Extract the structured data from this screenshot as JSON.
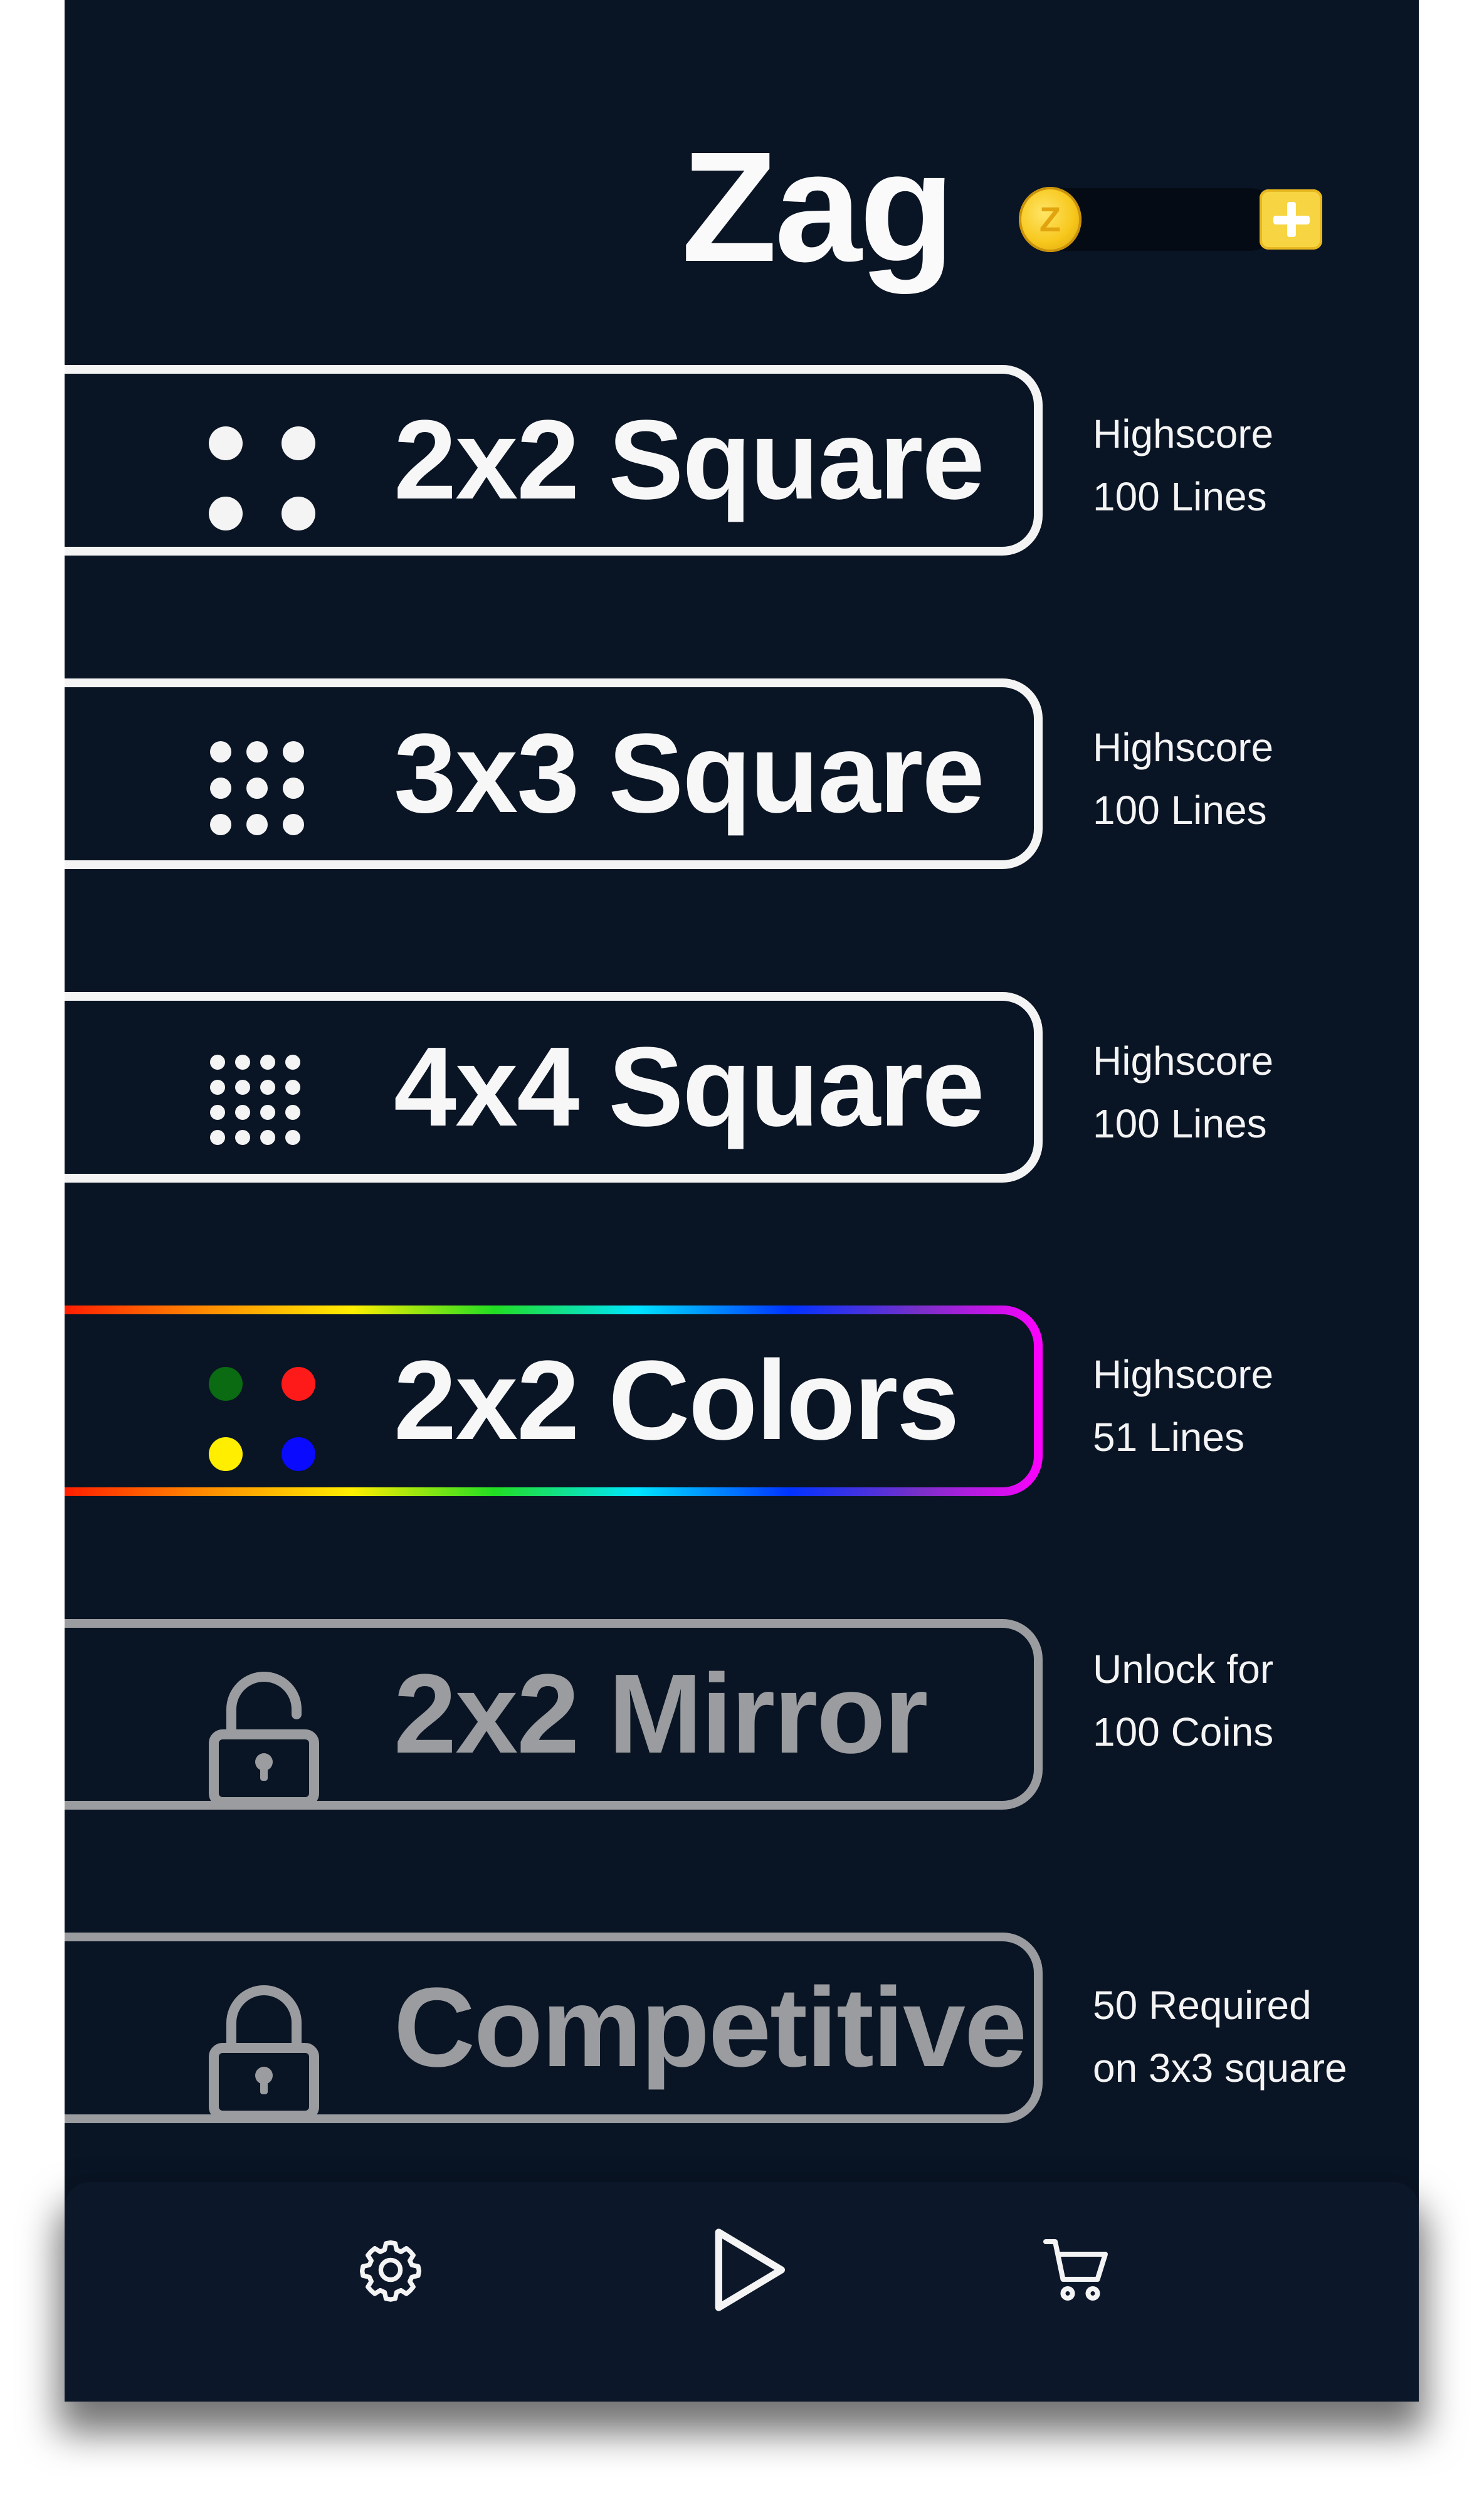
{
  "app": {
    "title": "Zag"
  },
  "wallet": {
    "coin_symbol": "Z",
    "coin_count": ""
  },
  "modes": [
    {
      "label": "2x2 Square",
      "status_line1": "Highscore",
      "status_line2": "100 Lines",
      "icon": "dots-2x2-icon"
    },
    {
      "label": "3x3 Square",
      "status_line1": "Highscore",
      "status_line2": "100 Lines",
      "icon": "dots-3x3-icon"
    },
    {
      "label": "4x4 Square",
      "status_line1": "Highscore",
      "status_line2": "100 Lines",
      "icon": "dots-4x4-icon"
    },
    {
      "label": "2x2 Colors",
      "status_line1": "Highscore",
      "status_line2": "51 Lines",
      "icon": "colored-dots-icon",
      "dot_colors": [
        "#0a6b12",
        "#ff1a1a",
        "#ffee00",
        "#0a0aff"
      ]
    },
    {
      "label": "2x2 Mirror",
      "status_line1": "Unlock for",
      "status_line2": "100 Coins",
      "icon": "unlocked-padlock-icon",
      "locked": true
    },
    {
      "label": "Competitive",
      "status_line1": "50 Required",
      "status_line2": "on 3x3 square",
      "icon": "padlock-icon",
      "locked": true
    }
  ],
  "bottom_nav": [
    {
      "name": "settings",
      "icon": "gear-icon"
    },
    {
      "name": "play",
      "icon": "play-icon"
    },
    {
      "name": "shop",
      "icon": "cart-icon"
    }
  ],
  "colors": {
    "background": "#091424",
    "button_border": "#f4f4f4",
    "locked": "#9a9c9f",
    "coin": "#f7c71c",
    "add_button": "#f7d542"
  }
}
